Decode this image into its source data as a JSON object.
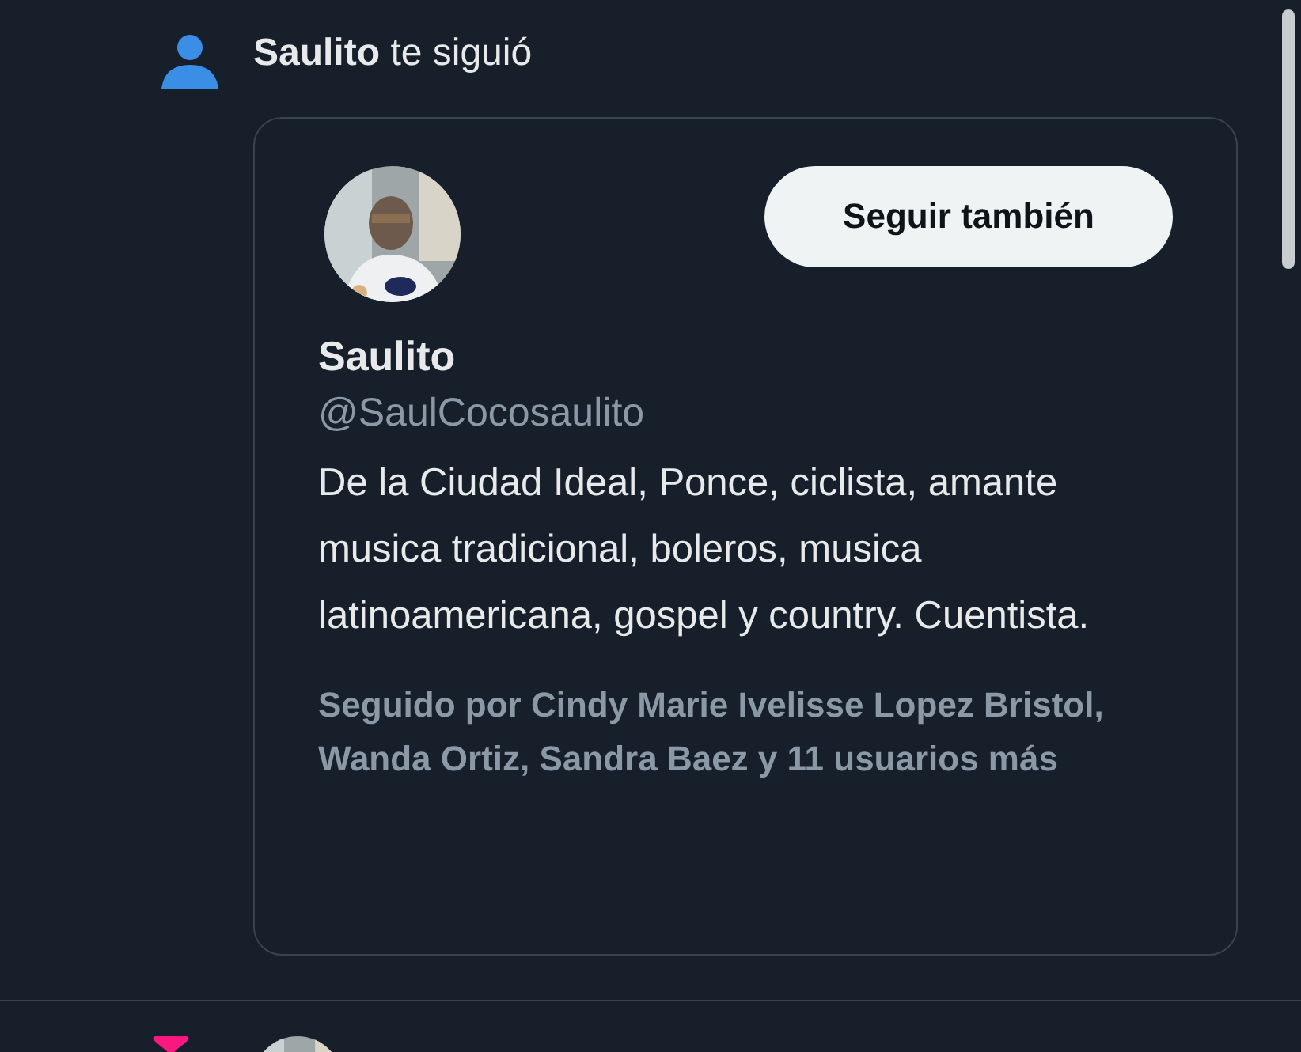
{
  "notification": {
    "actor": "Saulito",
    "action": "te siguió"
  },
  "card": {
    "follow_button": "Seguir también",
    "name": "Saulito",
    "handle": "@SaulCocosaulito",
    "bio": "De la Ciudad Ideal, Ponce, ciclista, amante musica tradicional, boleros, musica latinoamericana, gospel y country. Cuentista.",
    "followed_by": "Seguido por Cindy Marie Ivelisse Lopez Bristol, Wanda Ortiz, Sandra Baez y 11 usuarios más"
  }
}
